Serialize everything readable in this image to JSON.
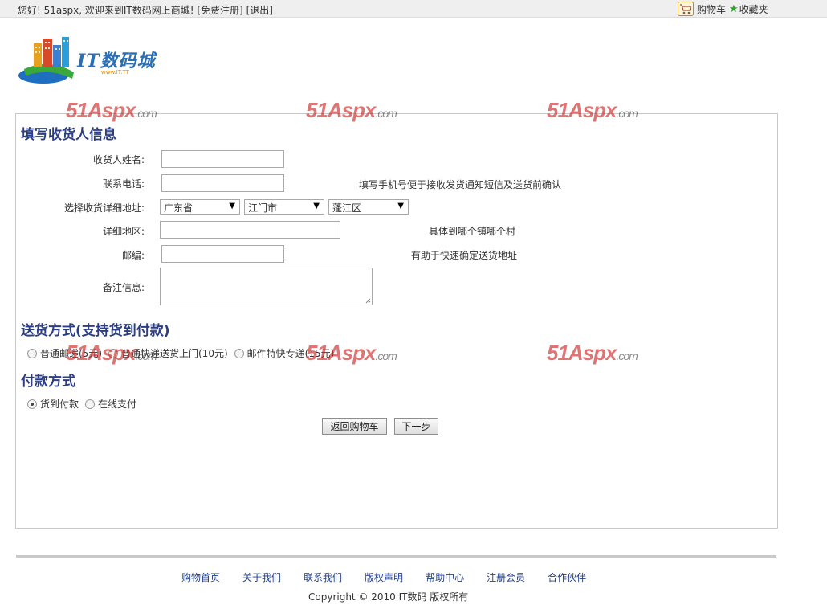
{
  "topbar": {
    "greeting": "您好! 51aspx, 欢迎来到IT数码网上商城!",
    "register_link": "[免费注册]",
    "logout_link": "[退出]",
    "cart_label": "购物车",
    "favorites_label": "收藏夹"
  },
  "logo": {
    "text": "IT数码城",
    "sub": "www.IT.TT"
  },
  "watermark": {
    "main": "51Aspx",
    "suffix": ".com"
  },
  "receiver": {
    "title": "填写收货人信息",
    "name_label": "收货人姓名:",
    "phone_label": "联系电话:",
    "phone_hint": "填写手机号便于接收发货通知短信及送货前确认",
    "address_label": "选择收货详细地址:",
    "province": "广东省",
    "city": "江门市",
    "district": "蓬江区",
    "detail_label": "详细地区:",
    "detail_hint": "具体到哪个镇哪个村",
    "zip_label": "邮编:",
    "zip_hint": "有助于快速确定送货地址",
    "remark_label": "备注信息:"
  },
  "delivery": {
    "title": "送货方式(支持货到付款)",
    "options": [
      "普通邮递(5元)",
      "普通快递送货上门(10元)",
      "邮件特快专递(15元)"
    ]
  },
  "payment": {
    "title": "付款方式",
    "options": [
      "货到付款",
      "在线支付"
    ]
  },
  "buttons": {
    "back": "返回购物车",
    "next": "下一步"
  },
  "footer": {
    "links": [
      "购物首页",
      "关于我们",
      "联系我们",
      "版权声明",
      "帮助中心",
      "注册会员",
      "合作伙伴"
    ],
    "copyright": "Copyright © 2010 IT数码 版权所有"
  }
}
